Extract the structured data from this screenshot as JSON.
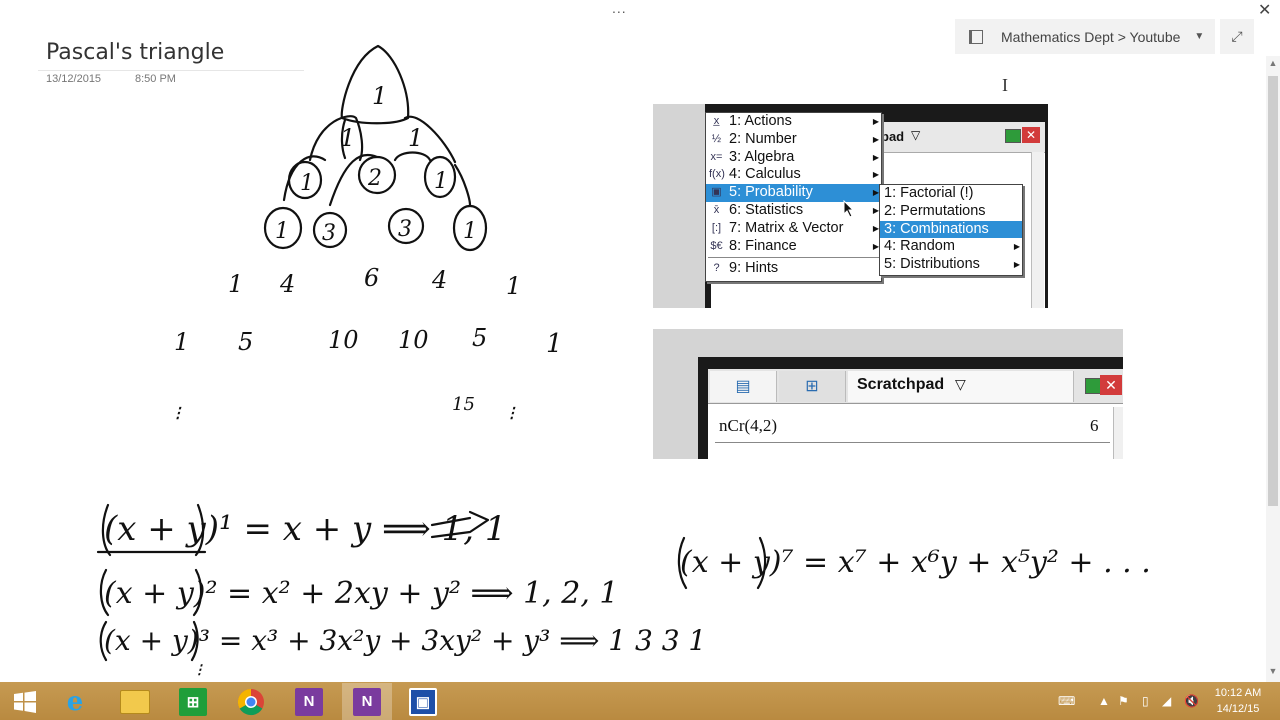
{
  "window": {
    "dots": "...",
    "close_glyph": "✕"
  },
  "notebook_bar": {
    "label": "Mathematics Dept > Youtube",
    "caret": "▼",
    "expand_glyph": "⤢"
  },
  "page": {
    "title": "Pascal's triangle",
    "date": "13/12/2015",
    "time": "8:50 PM"
  },
  "handwriting": {
    "row1": [
      "1"
    ],
    "row2": [
      "1",
      "1"
    ],
    "row3": [
      "1",
      "2",
      "1"
    ],
    "row4": [
      "1",
      "3",
      "3",
      "1"
    ],
    "row5": [
      "1",
      "4",
      "6",
      "4",
      "1"
    ],
    "row6": [
      "1",
      "5",
      "10",
      "10",
      "5",
      "1"
    ],
    "row7_partial": "15",
    "eq1": "(x + y)¹ = x + y   ⟹ 1, 1",
    "eq2": "(x + y)² = x² + 2xy + y² ⟹ 1, 2, 1",
    "eq3": "(x + y)³ = x³ + 3x²y + 3xy² + y³ ⟹ 1 3 3 1",
    "eq7": "(x + y)⁷ = x⁷ + x⁶y + x⁵y² + . . ."
  },
  "calc_menu": {
    "tab_title": "pad",
    "items": [
      {
        "label": "1: Actions",
        "icon": "x̲"
      },
      {
        "label": "2: Number",
        "icon": "½"
      },
      {
        "label": "3: Algebra",
        "icon": "x="
      },
      {
        "label": "4: Calculus",
        "icon": "f(x)"
      },
      {
        "label": "5: Probability",
        "icon": "▣"
      },
      {
        "label": "6: Statistics",
        "icon": "x̄"
      },
      {
        "label": "7: Matrix & Vector",
        "icon": "[:]"
      },
      {
        "label": "8: Finance",
        "icon": "$€"
      },
      {
        "label": "9: Hints",
        "icon": "?"
      }
    ],
    "selected_index": 4,
    "submenu": [
      {
        "label": "1: Factorial (!)"
      },
      {
        "label": "2: Permutations"
      },
      {
        "label": "3: Combinations"
      },
      {
        "label": "4: Random"
      },
      {
        "label": "5: Distributions"
      }
    ],
    "submenu_selected_index": 2
  },
  "scratchpad": {
    "tab_label": "Scratchpad",
    "caret": "▽",
    "expression": "nCr(4,2)",
    "result": "6"
  },
  "taskbar": {
    "time": "10:12 AM",
    "date": "14/12/15",
    "apps": [
      "start",
      "internet-explorer",
      "file-explorer",
      "store",
      "chrome",
      "onenote-sendto",
      "onenote",
      "screen-recorder"
    ],
    "colors": {
      "bar": "#c3974d",
      "onenote": "#7a3b9e",
      "store": "#1f9e3a"
    }
  }
}
